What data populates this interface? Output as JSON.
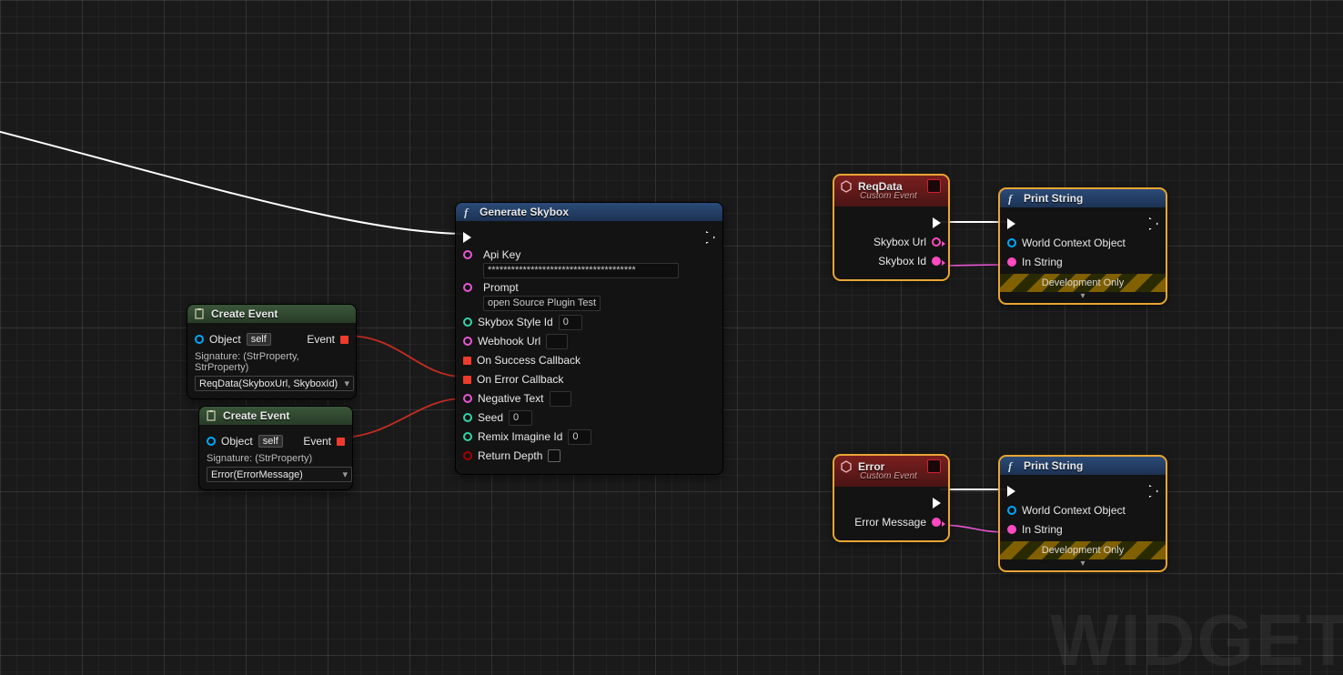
{
  "watermark": "WIDGET",
  "createEvent1": {
    "title": "Create Event",
    "objectLabel": "Object",
    "objectValue": "self",
    "eventLabel": "Event",
    "signature": "Signature: (StrProperty, StrProperty)",
    "dropdown": "ReqData(SkyboxUrl, SkyboxId)"
  },
  "createEvent2": {
    "title": "Create Event",
    "objectLabel": "Object",
    "objectValue": "self",
    "eventLabel": "Event",
    "signature": "Signature: (StrProperty)",
    "dropdown": "Error(ErrorMessage)"
  },
  "generateSkybox": {
    "title": "Generate Skybox",
    "apiKeyLabel": "Api Key",
    "apiKeyValue": "**************************************",
    "promptLabel": "Prompt",
    "promptValue": "open Source Plugin Test",
    "skyboxStyleIdLabel": "Skybox Style Id",
    "skyboxStyleIdValue": "0",
    "webhookUrlLabel": "Webhook Url",
    "webhookUrlValue": "",
    "onSuccessLabel": "On Success Callback",
    "onErrorLabel": "On Error Callback",
    "negativeTextLabel": "Negative Text",
    "negativeTextValue": "",
    "seedLabel": "Seed",
    "seedValue": "0",
    "remixLabel": "Remix Imagine Id",
    "remixValue": "0",
    "returnDepthLabel": "Return Depth"
  },
  "reqData": {
    "title": "ReqData",
    "subtitle": "Custom Event",
    "skyboxUrlLabel": "Skybox Url",
    "skyboxIdLabel": "Skybox Id"
  },
  "error": {
    "title": "Error",
    "subtitle": "Custom Event",
    "errorMessageLabel": "Error Message"
  },
  "printString1": {
    "title": "Print String",
    "worldContextLabel": "World Context Object",
    "inStringLabel": "In String",
    "devOnly": "Development Only"
  },
  "printString2": {
    "title": "Print String",
    "worldContextLabel": "World Context Object",
    "inStringLabel": "In String",
    "devOnly": "Development Only"
  }
}
